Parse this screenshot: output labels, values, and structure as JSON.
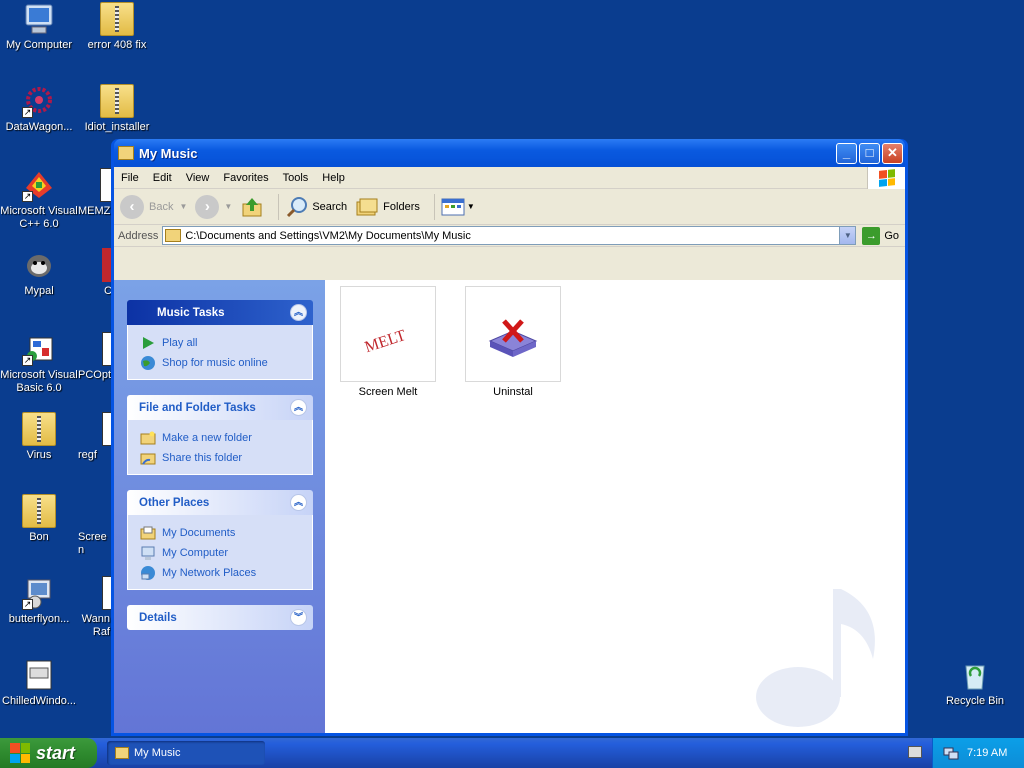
{
  "desktop": {
    "icons": [
      {
        "label": "My Computer",
        "icon": "my-computer-icon"
      },
      {
        "label": "error 408 fix",
        "icon": "zip-folder-icon"
      },
      {
        "label": "DataWagon...",
        "icon": "datawagon-icon"
      },
      {
        "label": "Idiot_installer",
        "icon": "zip-folder-icon"
      },
      {
        "label": "Microsoft Visual C++ 6.0",
        "icon": "visual-cpp-icon"
      },
      {
        "label": "MEMZ",
        "icon": "memz-icon"
      },
      {
        "label": "Mypal",
        "icon": "mypal-icon"
      },
      {
        "label": "C",
        "icon": "app-icon"
      },
      {
        "label": "Microsoft Visual Basic 6.0",
        "icon": "visual-basic-icon"
      },
      {
        "label": "PCOpt",
        "icon": "app-icon"
      },
      {
        "label": "Virus",
        "icon": "zip-folder-icon"
      },
      {
        "label": "regf",
        "icon": "app-icon"
      },
      {
        "label": "Bon",
        "icon": "zip-folder-icon"
      },
      {
        "label": "Screen",
        "icon": "app-icon"
      },
      {
        "label": "butterflyon...",
        "icon": "butterfly-icon"
      },
      {
        "label": "Wann Raf",
        "icon": "app-icon"
      },
      {
        "label": "ChilledWindo...",
        "icon": "window-app-icon"
      },
      {
        "label": "Recycle Bin",
        "icon": "recycle-bin-icon"
      }
    ]
  },
  "window": {
    "title": "My Music",
    "menu": [
      "File",
      "Edit",
      "View",
      "Favorites",
      "Tools",
      "Help"
    ],
    "toolbar": {
      "back": "Back",
      "search": "Search",
      "folders": "Folders"
    },
    "address": {
      "label": "Address",
      "path": "C:\\Documents and Settings\\VM2\\My Documents\\My Music",
      "go": "Go"
    },
    "task_panels": {
      "music_tasks": {
        "title": "Music Tasks",
        "items": [
          "Play all",
          "Shop for music online"
        ]
      },
      "file_folder_tasks": {
        "title": "File and Folder Tasks",
        "items": [
          "Make a new folder",
          "Share this folder"
        ]
      },
      "other_places": {
        "title": "Other Places",
        "items": [
          "My Documents",
          "My Computer",
          "My Network Places"
        ]
      },
      "details": {
        "title": "Details"
      }
    },
    "files": [
      {
        "name": "Screen Melt",
        "thumb_text": "MELT"
      },
      {
        "name": "Uninstal",
        "icon": "uninstall-icon"
      }
    ]
  },
  "taskbar": {
    "start_label": "start",
    "task_button": "My Music",
    "clock": "7:19 AM"
  }
}
